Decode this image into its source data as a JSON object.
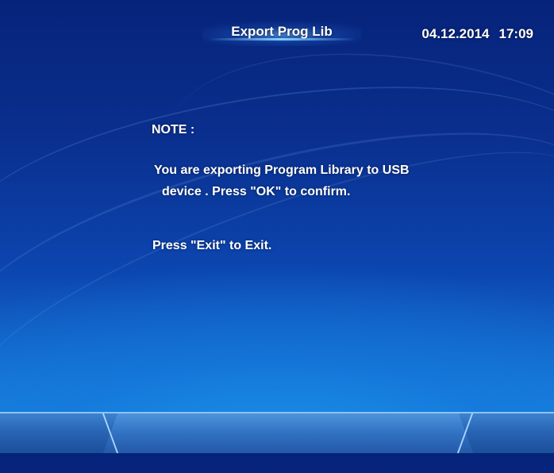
{
  "header": {
    "title": "Export Prog Lib",
    "date": "04.12.2014",
    "time": "17:09"
  },
  "dialog": {
    "note_label": "NOTE :",
    "message_line1": "You are exporting Program Library to USB",
    "message_line2": "device . Press \"OK\" to confirm.",
    "exit_message": "Press \"Exit\" to Exit."
  },
  "colors": {
    "background_top": "#06237a",
    "background_bottom": "#1a8ee6",
    "text": "#ffffff",
    "accent_glow": "#7fd0ff"
  }
}
